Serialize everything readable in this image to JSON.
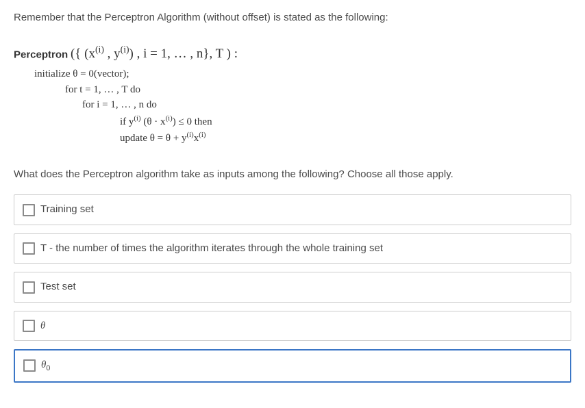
{
  "intro": "Remember that the Perceptron Algorithm (without offset) is stated as the following:",
  "algorithm": {
    "name": "Perceptron",
    "args_html": "({ (x<sup>(i)</sup> , y<sup>(i)</sup>) , i = 1, … , n}, T ) :",
    "line1_html": "initialize θ = 0(vector);",
    "line2_html": "for t = 1, … , T do",
    "line3_html": "for i = 1, … , n do",
    "line4_html": "if y<sup>(i)</sup> (θ · x<sup>(i)</sup>) ≤ 0 then",
    "line5_html": "update θ = θ + y<sup>(i)</sup>x<sup>(i)</sup>"
  },
  "question": "What does the Perceptron algorithm take as inputs among the following? Choose all those apply.",
  "options": [
    {
      "label": "Training set",
      "selected": false
    },
    {
      "label": "T - the number of times the algorithm iterates through the whole training set",
      "selected": false
    },
    {
      "label": "Test set",
      "selected": false
    },
    {
      "label_html": "<span class='italic'>θ</span>",
      "label": "θ",
      "selected": false
    },
    {
      "label_html": "<span class='italic'>θ</span><sub>0</sub>",
      "label": "θ0",
      "selected": true
    }
  ]
}
